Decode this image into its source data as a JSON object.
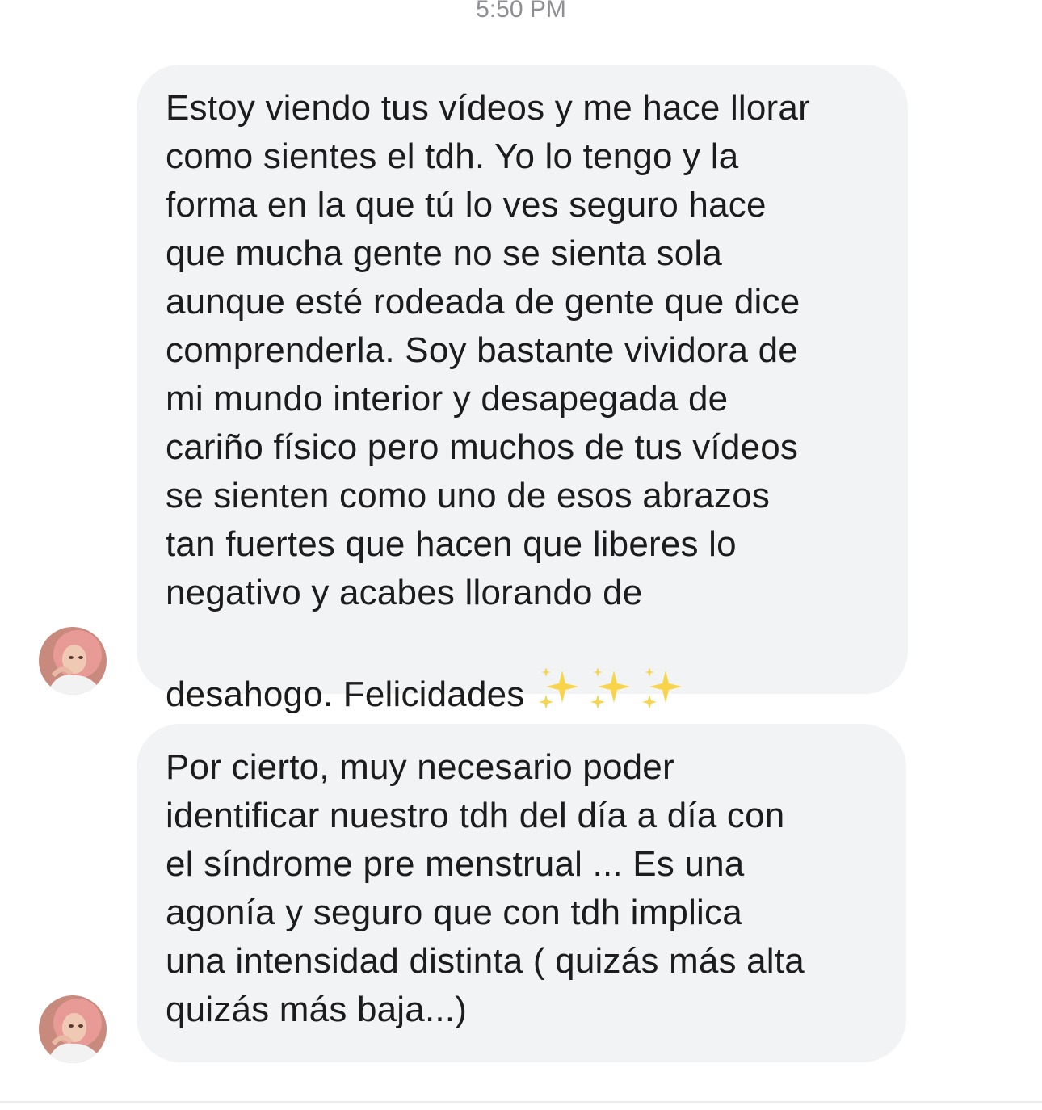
{
  "conversation": {
    "timestamp": "5:50 PM",
    "messages": [
      {
        "text": "Estoy viendo tus vídeos y me hace llorar\ncomo sientes el tdh. Yo lo tengo y la\nforma en la que tú lo ves seguro hace\nque mucha gente no se sienta sola\naunque esté rodeada de gente que dice\ncomprenderla. Soy bastante vividora de\nmi mundo interior y desapegada de\ncariño físico pero muchos de tus vídeos\nse sienten como uno de esos abrazos\ntan fuertes que hacen que liberes lo\nnegativo y acabes llorando de\ndesahogo. Felicidades",
        "emoji": "sparkles-icon x3"
      },
      {
        "text": "Por cierto, muy necesario poder\nidentificar nuestro tdh del día a día con\nel síndrome pre menstrual ... Es una\nagonía y seguro que con tdh implica\nuna intensidad distinta ( quizás más alta\nquizás más baja...)"
      }
    ]
  },
  "colors": {
    "bubble_bg": "#f2f3f5",
    "text": "#1c1c1e",
    "timestamp": "#8e8e93",
    "sparkle": "#f7d44a"
  }
}
